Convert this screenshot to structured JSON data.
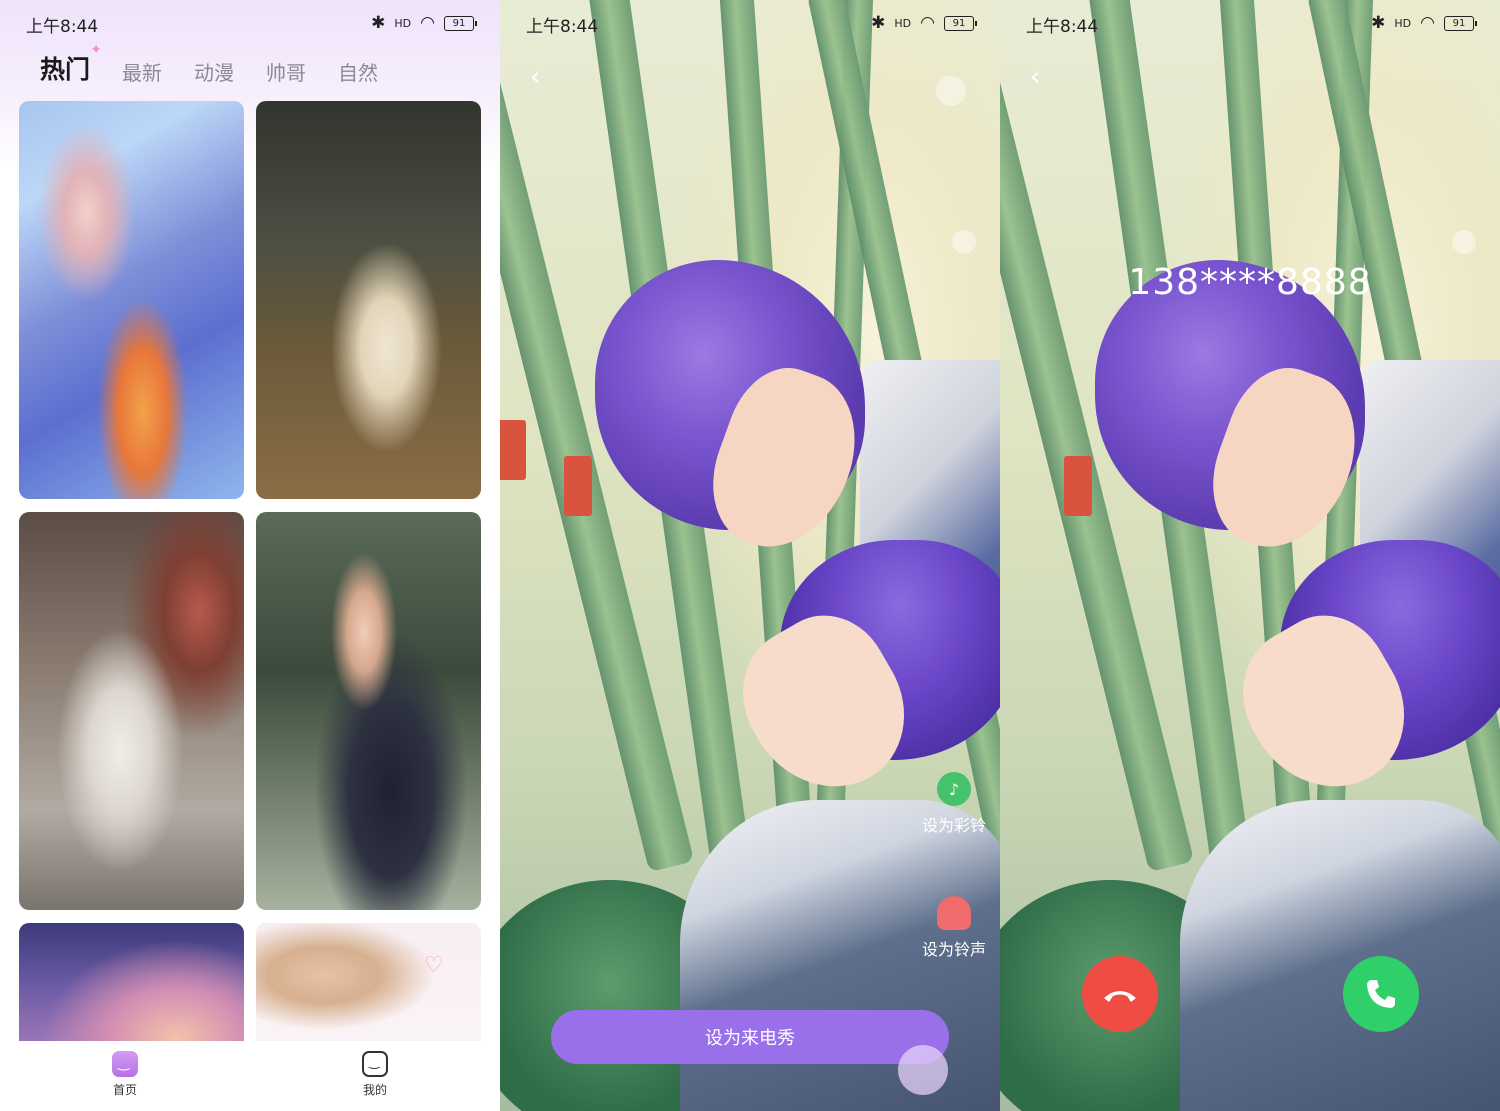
{
  "status": {
    "time": "上午8:44",
    "signal": "HD",
    "battery": "91"
  },
  "home": {
    "tabs": [
      {
        "label": "热门",
        "active": true
      },
      {
        "label": "最新",
        "active": false
      },
      {
        "label": "动漫",
        "active": false
      },
      {
        "label": "帅哥",
        "active": false
      },
      {
        "label": "自然",
        "active": false
      }
    ],
    "nav": {
      "home": "首页",
      "mine": "我的"
    }
  },
  "preview": {
    "ring_label": "设为彩铃",
    "tone_label": "设为铃声",
    "cta": "设为来电秀"
  },
  "call": {
    "number": "138****8888"
  },
  "colors": {
    "accent": "#9a70ea",
    "decline": "#ef4d43",
    "accept": "#2fcf69"
  }
}
